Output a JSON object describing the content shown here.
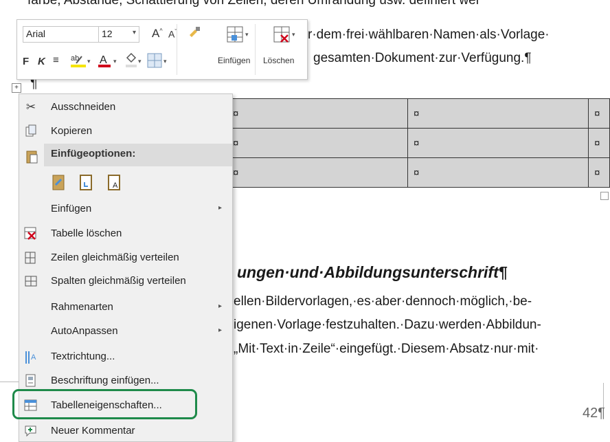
{
  "document": {
    "cutoff_line": "farbe, Abstände, Schattierung von Zeilen, deren Umrandung usw. definiert wer",
    "line1": "r·dem·frei·wählbaren·Namen·als·Vorlage·",
    "line2": "gesamten·Dokument·zur·Verfügung.¶",
    "paragraph_mark": "¶",
    "table_rows": [
      [
        "¤",
        "¤",
        "¤"
      ],
      [
        "¤",
        "¤",
        "¤"
      ],
      [
        "¤",
        "¤",
        "¤"
      ]
    ],
    "heading": "ungen·und·Abbildungsunterschrift¶",
    "body1": "ellen·Bildervorlagen,·es·aber·dennoch·möglich,·be-",
    "body2": "igenen·Vorlage·festzuhalten.·Dazu·werden·Abbildun-",
    "body3": "„Mit·Text·in·Zeile“·eingefügt.·Diesem·Absatz·nur·mit·",
    "page_number": "42¶"
  },
  "mini_toolbar": {
    "font_name": "Arial",
    "font_size": "12",
    "grow_font": "A",
    "shrink_font": "A",
    "bold": "F",
    "italic": "K",
    "font_color_letter": "A",
    "insert_label": "Einfügen",
    "delete_label": "Löschen"
  },
  "context_menu": {
    "items": [
      {
        "label": "Ausschneiden",
        "icon": "scissors-icon"
      },
      {
        "label": "Kopieren",
        "icon": "copy-icon"
      },
      {
        "label": "Einfügen",
        "icon": "",
        "submenu": true
      },
      {
        "label": "Tabelle löschen",
        "icon": "delete-table-icon"
      },
      {
        "label": "Zeilen gleichmäßig verteilen",
        "icon": "distribute-rows-icon"
      },
      {
        "label": "Spalten gleichmäßig verteilen",
        "icon": "distribute-columns-icon"
      },
      {
        "label": "Rahmenarten",
        "icon": "",
        "submenu": true
      },
      {
        "label": "AutoAnpassen",
        "icon": "",
        "submenu": true
      },
      {
        "label": "Textrichtung...",
        "icon": "text-direction-icon"
      },
      {
        "label": "Beschriftung einfügen...",
        "icon": "caption-icon"
      },
      {
        "label": "Tabelleneigenschaften...",
        "icon": "table-properties-icon"
      },
      {
        "label": "Neuer Kommentar",
        "icon": "comment-icon"
      }
    ],
    "paste_header": "Einfügeoptionen:",
    "paste_options": [
      "keep-source-format-icon",
      "merge-table-icon",
      "keep-text-only-icon"
    ]
  },
  "colors": {
    "highlight": "#1e8a4a",
    "font_color_red": "#d0021b",
    "highlight_yellow": "#f5e400"
  }
}
